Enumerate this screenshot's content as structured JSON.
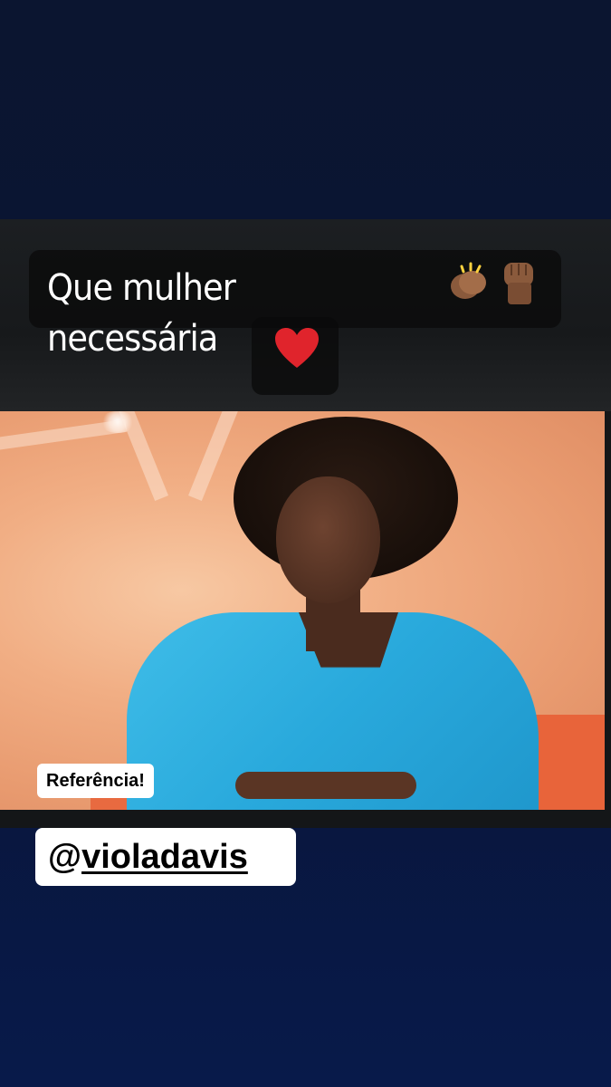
{
  "story": {
    "caption": "Que mulher necessária",
    "caption_emojis": [
      "clapping-hands-icon",
      "raised-fist-icon",
      "red-heart-icon"
    ],
    "label_tag": "Referência!",
    "mention": {
      "at": "@",
      "username": "violadavis"
    }
  },
  "colors": {
    "background": "#0a1533",
    "caption_bg": "#0a0a0a",
    "tag_bg": "#ffffff",
    "blazer": "#29a9dc"
  }
}
